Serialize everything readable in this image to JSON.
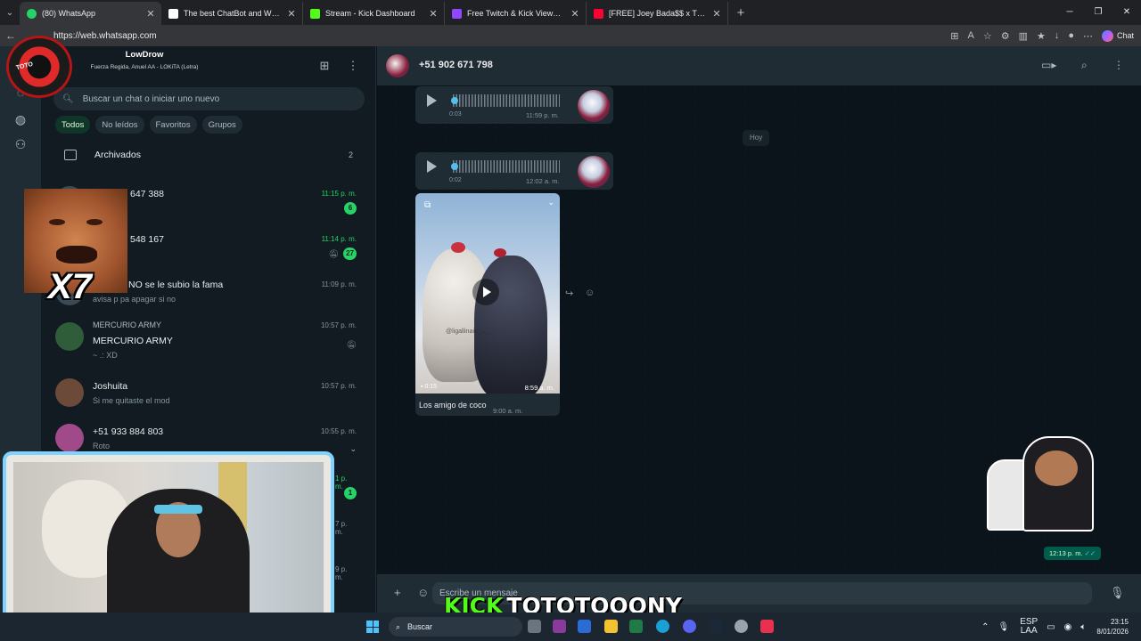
{
  "browser": {
    "tabs": [
      {
        "title": "(80) WhatsApp",
        "favicon_color": "#25d366",
        "active": true
      },
      {
        "title": "The best ChatBot and Widgets for",
        "favicon_color": "#ffffff",
        "active": false
      },
      {
        "title": "Stream - Kick Dashboard",
        "favicon_color": "#53fc18",
        "active": false
      },
      {
        "title": "Free Twitch & Kick Viewers - Try 1",
        "favicon_color": "#9146ff",
        "active": false
      },
      {
        "title": "[FREE] Joey Bada$$ x The Alchemi",
        "favicon_color": "#ff0033",
        "active": false
      }
    ],
    "url": "https://web.whatsapp.com",
    "chat_button_label": "Chat"
  },
  "overlay": {
    "profile_name": "LowDrow",
    "profile_song": "Fuerza Regida, Anuel AA - LOKiTA (Letra)",
    "multiplier": "X7",
    "kick_label": "KICK",
    "kick_channel": "TOTOTOOONY"
  },
  "sidebar": {
    "search_placeholder": "Buscar un chat o iniciar uno nuevo",
    "filters": [
      "Todos",
      "No leídos",
      "Favoritos",
      "Grupos"
    ],
    "archived_label": "Archivados",
    "archived_count": "2",
    "chats": [
      {
        "name": "+51 9_ 647 388",
        "name_visible": "647 388",
        "preview": "",
        "time": "11:15 p. m.",
        "time_green": true,
        "badge": "6",
        "muted": false
      },
      {
        "name": "548 167",
        "name_visible": "548 167",
        "preview": "",
        "time": "11:14 p. m.",
        "time_green": true,
        "badge": "27",
        "muted": true
      },
      {
        "name": "NO se le subio la fama",
        "name_visible": "NO se le subio la fama",
        "preview": "avisa p pa apagar si no",
        "time": "11:09 p. m.",
        "time_green": false,
        "badge": "",
        "muted": false
      },
      {
        "name": "MERCURIO ARMY",
        "name_visible": "MERCURIO ARMY",
        "preview": "~ .: XD",
        "time": "10:57 p. m.",
        "time_green": false,
        "badge": "",
        "muted": true,
        "group_label": "MERCURIO ARMY"
      },
      {
        "name": "Joshuita",
        "name_visible": "Joshuita",
        "preview": "Si me quitaste el mod",
        "time": "10:57 p. m.",
        "time_green": false,
        "badge": "",
        "muted": false
      },
      {
        "name": "+51 933 884 803",
        "name_visible": "+51 933 884 803",
        "preview": "Roto",
        "time": "10:55 p. m.",
        "time_green": false,
        "badge": "",
        "muted": false
      }
    ],
    "hidden_times": [
      "1 p. m.",
      "7 p. m.",
      "9 p. m."
    ],
    "hidden_badge": "1"
  },
  "conversation": {
    "contact": "+51 902 671 798",
    "day_label": "Hoy",
    "voice_messages": [
      {
        "duration": "0:03",
        "time": "11:59 p. m."
      },
      {
        "duration": "0:02",
        "time": "12:02 a. m."
      }
    ],
    "video": {
      "duration": "0:15",
      "time": "8:59 a. m.",
      "watermark": "@ligallinaio_..._",
      "caption": "Los amigo de coco",
      "caption_time": "9:00 a. m."
    },
    "sticker_time": "12:13 p. m.",
    "composer_placeholder": "Escribe un mensaje"
  },
  "taskbar": {
    "search_label": "Buscar",
    "lang_top": "ESP",
    "lang_bottom": "LAA",
    "time": "23:15",
    "date": "8/01/2026"
  }
}
